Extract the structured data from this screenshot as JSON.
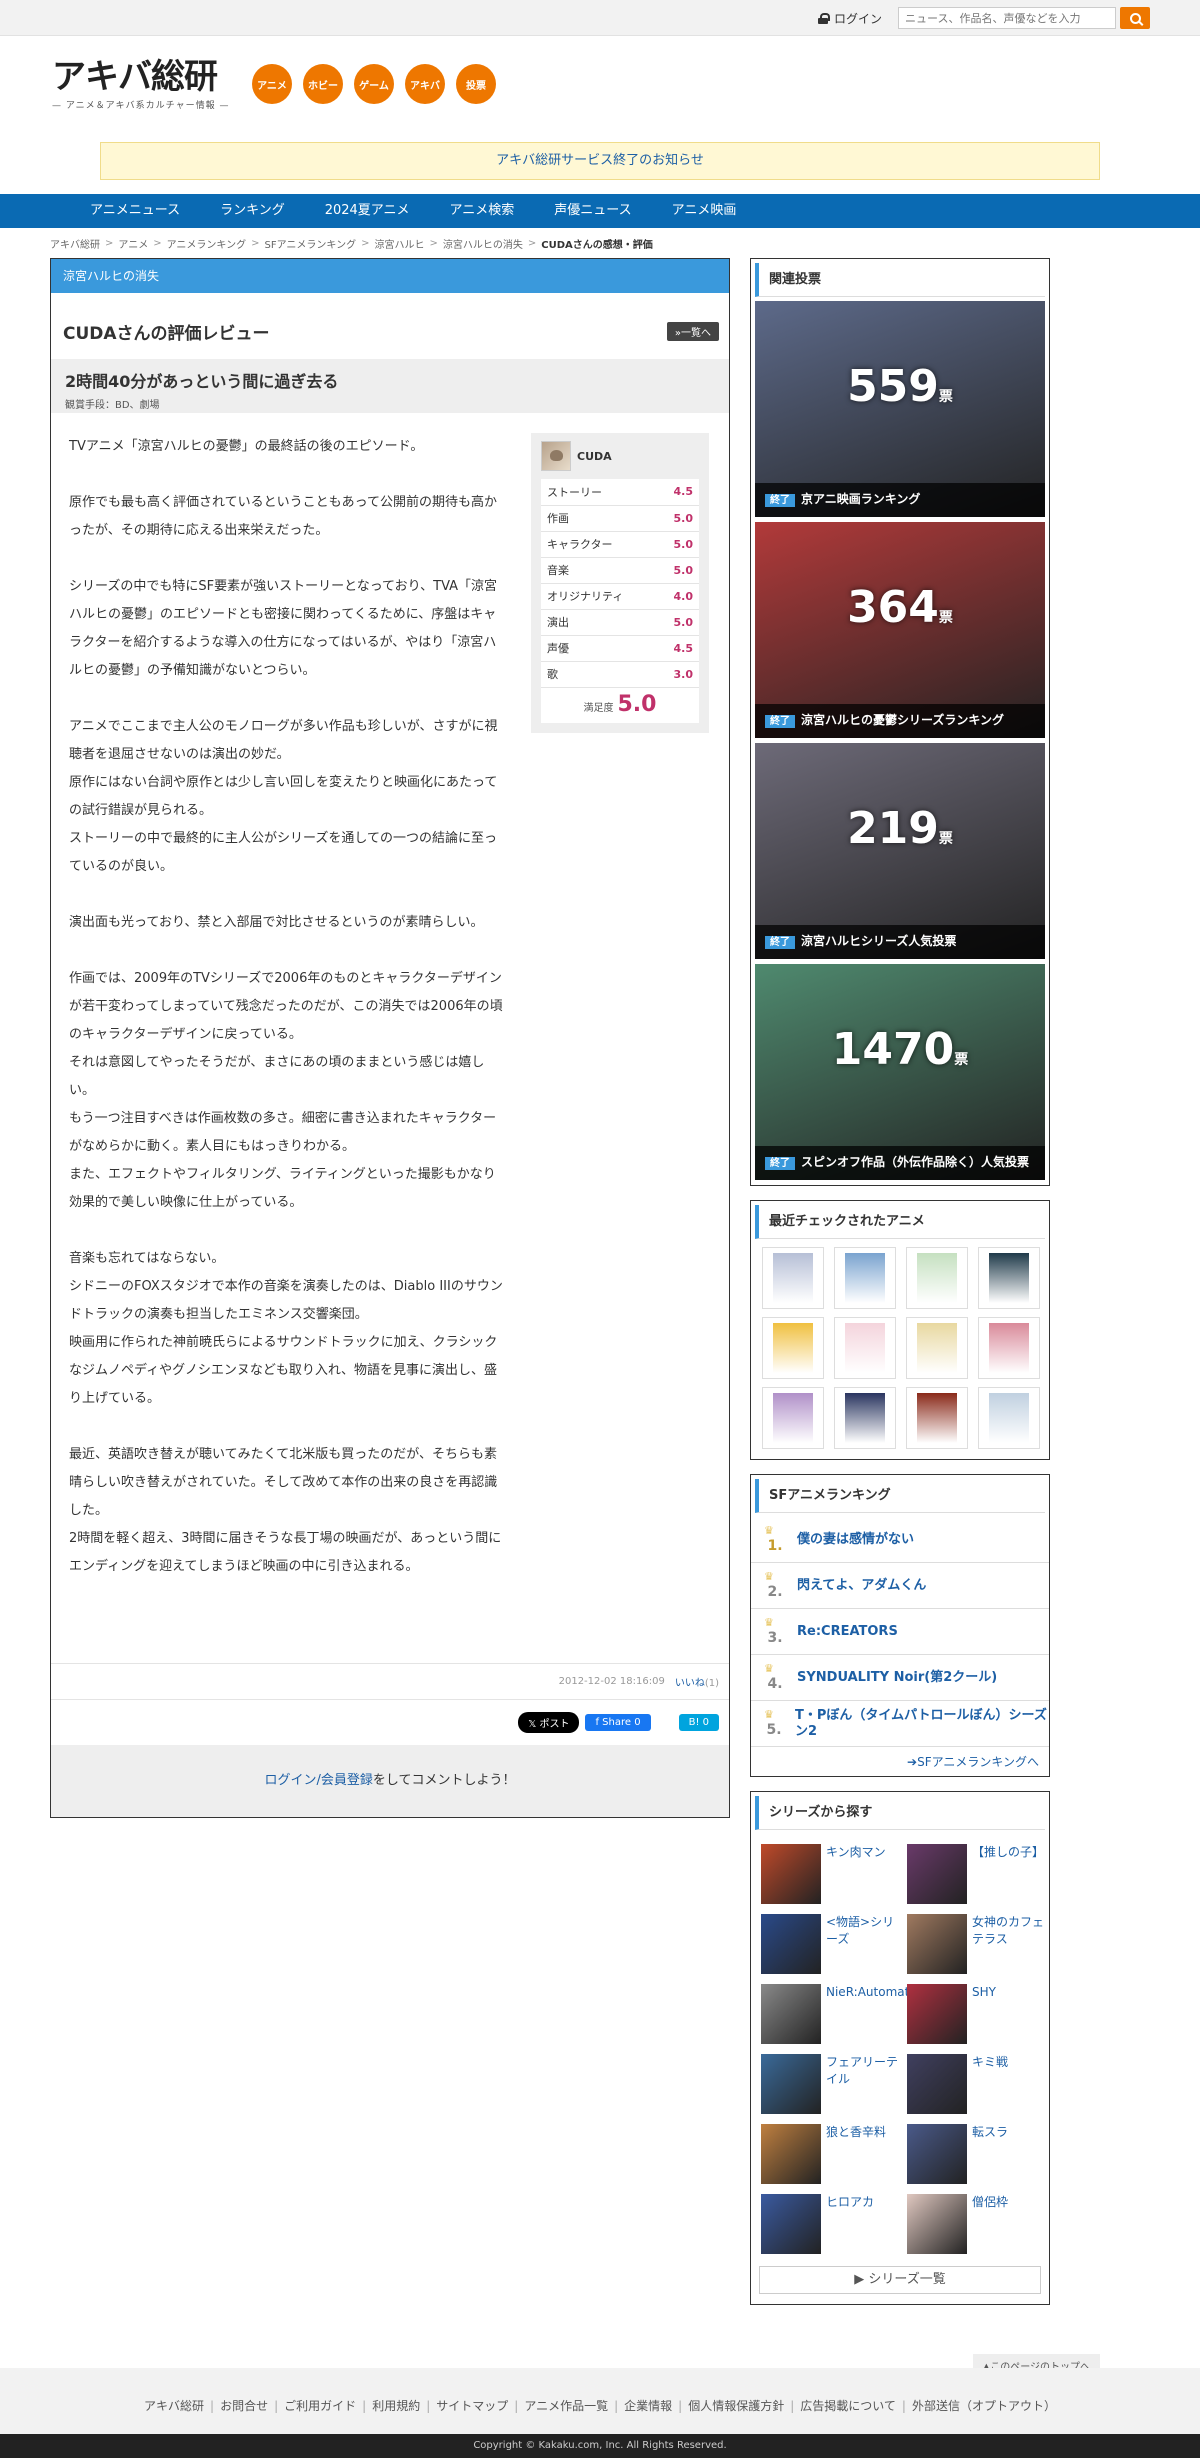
{
  "topbar": {
    "login": "ログイン",
    "search_placeholder": "ニュース、作品名、声優などを入力"
  },
  "header": {
    "logo": "アキバ総研",
    "logo_sub": "— アニメ＆アキバ系カルチャー情報 —",
    "categories": [
      "アニメ",
      "ホビー",
      "ゲーム",
      "アキバ",
      "投票"
    ]
  },
  "notice": "アキバ総研サービス終了のお知らせ",
  "gnav": [
    "アニメニュース",
    "ランキング",
    "2024夏アニメ",
    "アニメ検索",
    "声優ニュース",
    "アニメ映画"
  ],
  "breadcrumb": [
    "アキバ総研",
    "アニメ",
    "アニメランキング",
    "SFアニメランキング",
    "涼宮ハルヒ",
    "涼宮ハルヒの消失",
    "CUDAさんの感想・評価"
  ],
  "main": {
    "section_title": "涼宮ハルヒの消失",
    "review_title": "CUDAさんの評価レビュー",
    "to_list": "»一覧へ",
    "headline": "2時間40分があっという間に過ぎ去る",
    "method": "観賞手段：BD、劇場",
    "paragraphs": [
      [
        "TVアニメ「涼宮ハルヒの憂鬱」の最終話の後のエピソード。"
      ],
      [
        "原作でも最も高く評価されているということもあって公開前の期待も高かったが、その期待に応える出来栄えだった。"
      ],
      [
        "シリーズの中でも特にSF要素が強いストーリーとなっており、TVA「涼宮ハルヒの憂鬱」のエピソードとも密接に関わってくるために、序盤はキャラクターを紹介するような導入の仕方になってはいるが、やはり「涼宮ハルヒの憂鬱」の予備知識がないとつらい。"
      ],
      [
        "アニメでここまで主人公のモノローグが多い作品も珍しいが、さすがに視聴者を退屈させないのは演出の妙だ。",
        "原作にはない台詞や原作とは少し言い回しを変えたりと映画化にあたっての試行錯誤が見られる。",
        "ストーリーの中で最終的に主人公がシリーズを通しての一つの結論に至っているのが良い。"
      ],
      [
        "演出面も光っており、禁と入部届で対比させるというのが素晴らしい。"
      ],
      [
        "作画では、2009年のTVシリーズで2006年のものとキャラクターデザインが若干変わってしまっていて残念だったのだが、この消失では2006年の頃のキャラクターデザインに戻っている。",
        "それは意図してやったそうだが、まさにあの頃のままという感じは嬉しい。",
        "もう一つ注目すべきは作画枚数の多さ。細密に書き込まれたキャラクターがなめらかに動く。素人目にもはっきりわかる。",
        "また、エフェクトやフィルタリング、ライティングといった撮影もかなり効果的で美しい映像に仕上がっている。"
      ],
      [
        "音楽も忘れてはならない。",
        "シドニーのFOXスタジオで本作の音楽を演奏したのは、Diablo IIIのサウンドトラックの演奏も担当したエミネンス交響楽団。",
        "映画用に作られた神前暁氏らによるサウンドトラックに加え、クラシックなジムノペディやグノシエンヌなども取り入れ、物語を見事に演出し、盛り上げている。"
      ],
      [
        "最近、英語吹き替えが聴いてみたくて北米版も買ったのだが、そちらも素晴らしい吹き替えがされていた。そして改めて本作の出来の良さを再認識した。",
        "2時間を軽く超え、3時間に届きそうな長丁場の映画だが、あっという間にエンディングを迎えてしまうほど映画の中に引き込まれる。"
      ]
    ],
    "score": {
      "user": "CUDA",
      "rows": [
        {
          "label": "ストーリー",
          "value": "4.5"
        },
        {
          "label": "作画",
          "value": "5.0"
        },
        {
          "label": "キャラクター",
          "value": "5.0"
        },
        {
          "label": "音楽",
          "value": "5.0"
        },
        {
          "label": "オリジナリティ",
          "value": "4.0"
        },
        {
          "label": "演出",
          "value": "5.0"
        },
        {
          "label": "声優",
          "value": "4.5"
        },
        {
          "label": "歌",
          "value": "3.0"
        }
      ],
      "satisfaction_label": "満足度",
      "satisfaction": "5.0"
    },
    "date": "2012-12-02 18:16:09",
    "like": "いいね",
    "like_count": "(1)",
    "share": {
      "x": "𝕏 ポスト",
      "fb": "f Share 0",
      "hb": "B! 0"
    },
    "comment_link": "ログイン/会員登録",
    "comment_rest": "をしてコメントしよう！"
  },
  "sidebar": {
    "votes_title": "関連投票",
    "votes": [
      {
        "count": "559",
        "unit": "票",
        "status": "終了",
        "title": "京アニ映画ランキング",
        "bg": "#5d6a8a"
      },
      {
        "count": "364",
        "unit": "票",
        "status": "終了",
        "title": "涼宮ハルヒの憂鬱シリーズランキング",
        "bg": "#b23a3a"
      },
      {
        "count": "219",
        "unit": "票",
        "status": "終了",
        "title": "涼宮ハルヒシリーズ人気投票",
        "bg": "#6d6a78"
      },
      {
        "count": "1470",
        "unit": "票",
        "status": "終了",
        "title": "スピンオフ作品（外伝作品除く）人気投票",
        "bg": "#4f8a6f"
      }
    ],
    "recent_title": "最近チェックされたアニメ",
    "recent_colors": [
      "#b6bfd6",
      "#7aa3cf",
      "#c5e0c0",
      "#1f3a4a",
      "#f0c040",
      "#f4d4dc",
      "#e8d8a0",
      "#d98a9a",
      "#b090c8",
      "#2a3560",
      "#8a2a1a",
      "#c0d0e0"
    ],
    "ranking_title": "SFアニメランキング",
    "ranking": [
      "僕の妻は感情がない",
      "閃えてよ、アダムくん",
      "Re:CREATORS",
      "SYNDUALITY Noir(第2クール)",
      "T・Pぼん（タイムパトロールぼん）シーズン2"
    ],
    "ranking_more": "SFアニメランキングへ",
    "series_title": "シリーズから探す",
    "series": [
      {
        "name": "キン肉マン",
        "color": "#c04a2a"
      },
      {
        "name": "【推しの子】",
        "color": "#6a3a6a"
      },
      {
        "name": "<物語>シリーズ",
        "color": "#2a4a8a"
      },
      {
        "name": "女神のカフェテラス",
        "color": "#a07a60"
      },
      {
        "name": "NieR:Automata",
        "color": "#8a8a8a"
      },
      {
        "name": "SHY",
        "color": "#b03040"
      },
      {
        "name": "フェアリーテイル",
        "color": "#3a6a9a"
      },
      {
        "name": "キミ戦",
        "color": "#404060"
      },
      {
        "name": "狼と香辛料",
        "color": "#c08040"
      },
      {
        "name": "転スラ",
        "color": "#4a5a8a"
      },
      {
        "name": "ヒロアカ",
        "color": "#3a5aa0"
      },
      {
        "name": "僧侶枠",
        "color": "#e0c8c0"
      }
    ],
    "series_more": "シリーズ一覧"
  },
  "pagetop": "▲このページのトップへ",
  "footer_links": [
    "アキバ総研",
    "お問合せ",
    "ご利用ガイド",
    "利用規約",
    "サイトマップ",
    "アニメ作品一覧",
    "企業情報",
    "個人情報保護方針",
    "広告掲載について",
    "外部送信（オプトアウト）"
  ],
  "copyright": "Copyright © Kakaku.com, Inc. All Rights Reserved."
}
